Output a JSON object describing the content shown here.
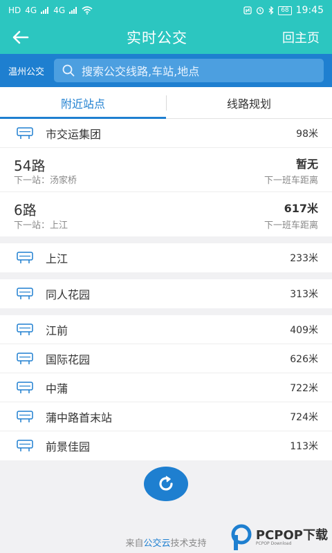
{
  "status_bar": {
    "network_left": "HD",
    "signal_4g_1": "4G",
    "signal_4g_2": "4G",
    "battery": "68",
    "time": "19:45"
  },
  "header": {
    "title": "实时公交",
    "home_label": "回主页"
  },
  "search": {
    "city": "温州公交",
    "placeholder": "搜索公交线路,车站,地点"
  },
  "tabs": [
    {
      "label": "附近站点",
      "active": true
    },
    {
      "label": "线路规划",
      "active": false
    }
  ],
  "group1": {
    "stop": {
      "name": "市交运集团",
      "distance": "98米"
    },
    "routes": [
      {
        "name": "54路",
        "next_stop": "下一站：汤家桥",
        "status": "暂无",
        "hint": "下一班车距离"
      },
      {
        "name": "6路",
        "next_stop": "下一站：上江",
        "status": "617米",
        "hint": "下一班车距离"
      }
    ]
  },
  "stops_a": [
    {
      "name": "上江",
      "distance": "233米"
    }
  ],
  "stops_b": [
    {
      "name": "同人花园",
      "distance": "313米"
    }
  ],
  "stops_c": [
    {
      "name": "江前",
      "distance": "409米"
    },
    {
      "name": "国际花园",
      "distance": "626米"
    },
    {
      "name": "中蒲",
      "distance": "722米"
    },
    {
      "name": "蒲中路首末站",
      "distance": "724米"
    },
    {
      "name": "前景佳园",
      "distance": "113米"
    }
  ],
  "footer": {
    "prefix": "来自",
    "highlight": "公交云",
    "suffix": "技术支持"
  },
  "watermark": {
    "text": "PCPOP下载",
    "sub": "PCPOP Download"
  },
  "colors": {
    "header": "#2cc6c0",
    "accent": "#1e7fd0"
  }
}
